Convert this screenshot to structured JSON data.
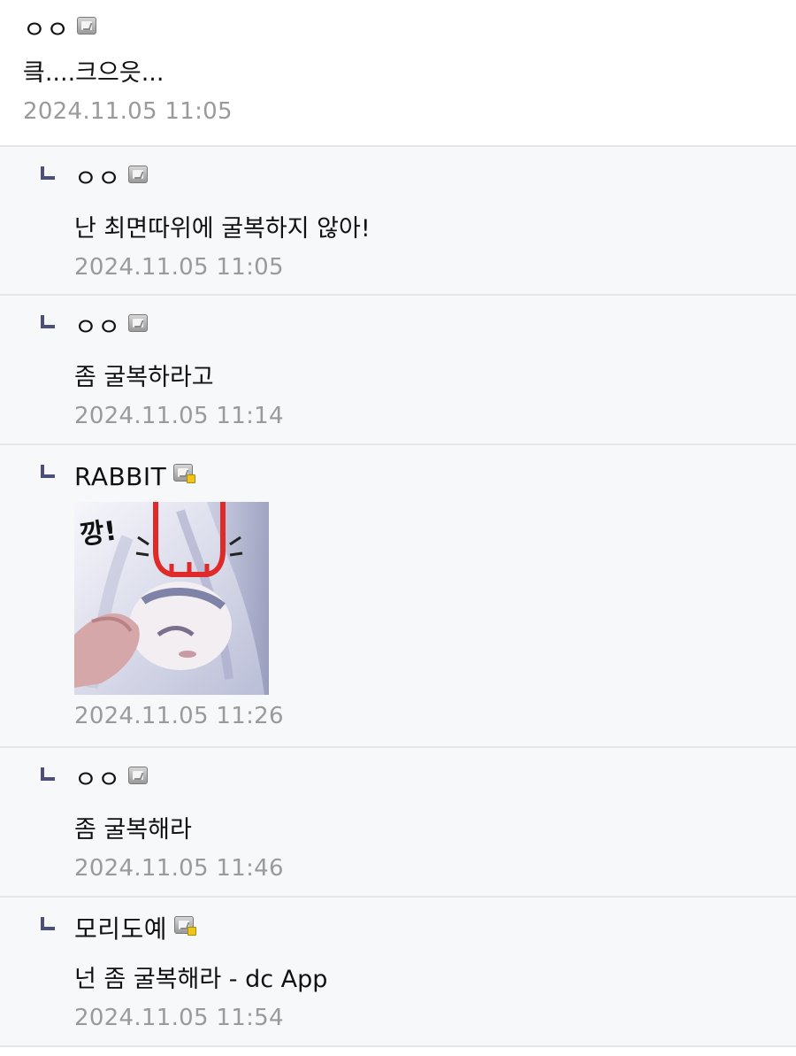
{
  "comments": [
    {
      "type": "top",
      "nick": "ㅇㅇ",
      "icon": "gallery-icon",
      "text": "킄....크으읏...",
      "date": "2024.11.05 11:05"
    },
    {
      "type": "reply",
      "nick": "ㅇㅇ",
      "icon": "gallery-icon",
      "text": "난 최면따위에 굴복하지 않아!",
      "date": "2024.11.05 11:05"
    },
    {
      "type": "reply",
      "nick": "ㅇㅇ",
      "icon": "gallery-icon",
      "text": "좀 굴복하라고",
      "date": "2024.11.05 11:14"
    },
    {
      "type": "reply",
      "nick": "RABBIT",
      "icon": "fixed-gallery-icon",
      "sticker_text": "깡!",
      "date": "2024.11.05 11:26"
    },
    {
      "type": "reply",
      "nick": "ㅇㅇ",
      "icon": "gallery-icon",
      "text": "좀 굴복해라",
      "date": "2024.11.05 11:46"
    },
    {
      "type": "reply",
      "nick": "모리도예",
      "icon": "fixed-gallery-icon",
      "text": "넌 좀 굴복해라 - dc App",
      "date": "2024.11.05 11:54"
    }
  ],
  "colors": {
    "reply_background": "#f7f8fa",
    "divider": "#e4e6ea",
    "reply_mark": "#4b4f7a",
    "date_text": "#9a9a9a",
    "fixed_badge": "#f2c318"
  }
}
